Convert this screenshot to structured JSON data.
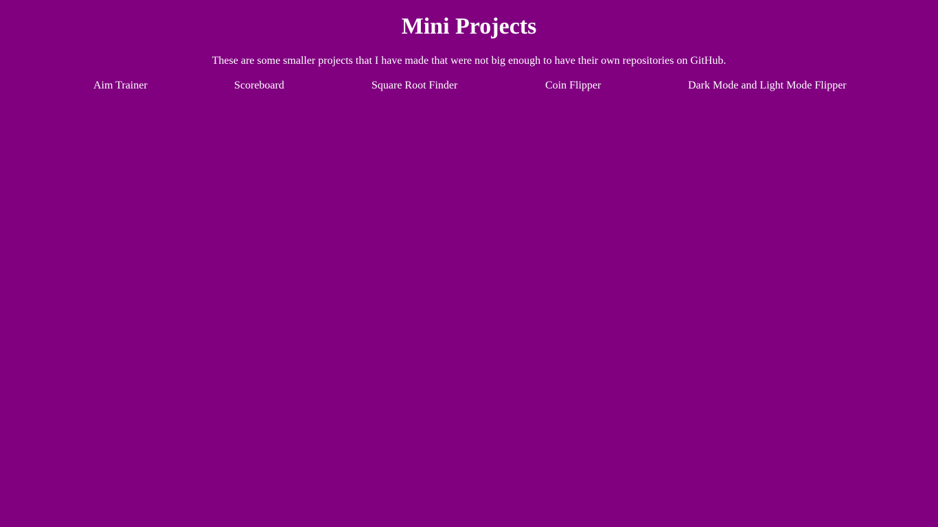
{
  "page": {
    "title": "Mini Projects",
    "description": "These are some smaller projects that I have made that were not big enough to have their own repositories on GitHub.",
    "background_color": "#800080",
    "text_color": "#ffffff"
  },
  "projects": [
    {
      "label": "Aim Trainer"
    },
    {
      "label": "Scoreboard"
    },
    {
      "label": "Square Root Finder"
    },
    {
      "label": "Coin Flipper"
    },
    {
      "label": "Dark Mode and Light Mode Flipper"
    }
  ]
}
